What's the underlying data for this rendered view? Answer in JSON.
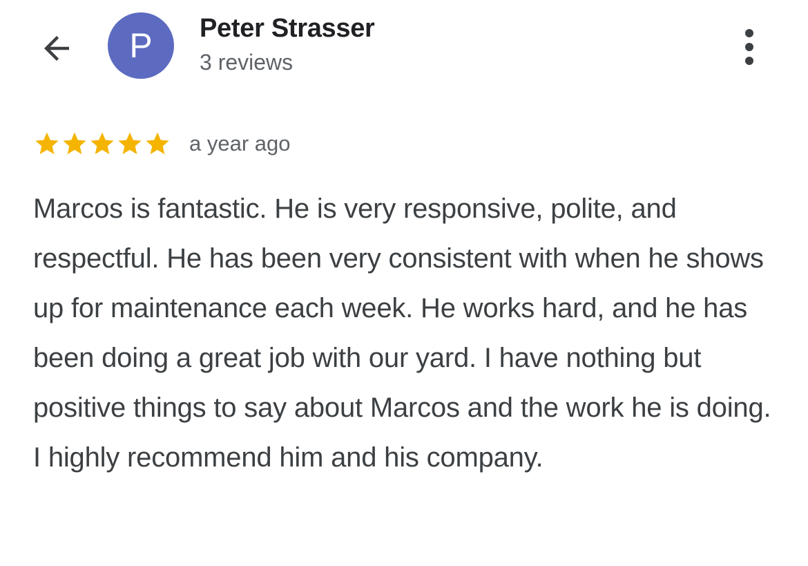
{
  "header": {
    "back_icon": "arrow-back-icon",
    "avatar_letter": "P",
    "avatar_color": "#5c6bc0",
    "reviewer_name": "Peter Strasser",
    "review_count": "3 reviews",
    "more_icon": "more-vert-icon"
  },
  "review": {
    "rating": 5,
    "rating_max": 5,
    "star_color": "#f4b400",
    "time": "a year ago",
    "text": "Marcos is fantastic. He is very responsive, polite, and respectful. He has been very consistent with when he shows up for maintenance each week. He works hard, and he has been doing a great job with our yard. I have nothing but positive things to say about Marcos and the work he is doing. I highly recommend him and his company."
  }
}
